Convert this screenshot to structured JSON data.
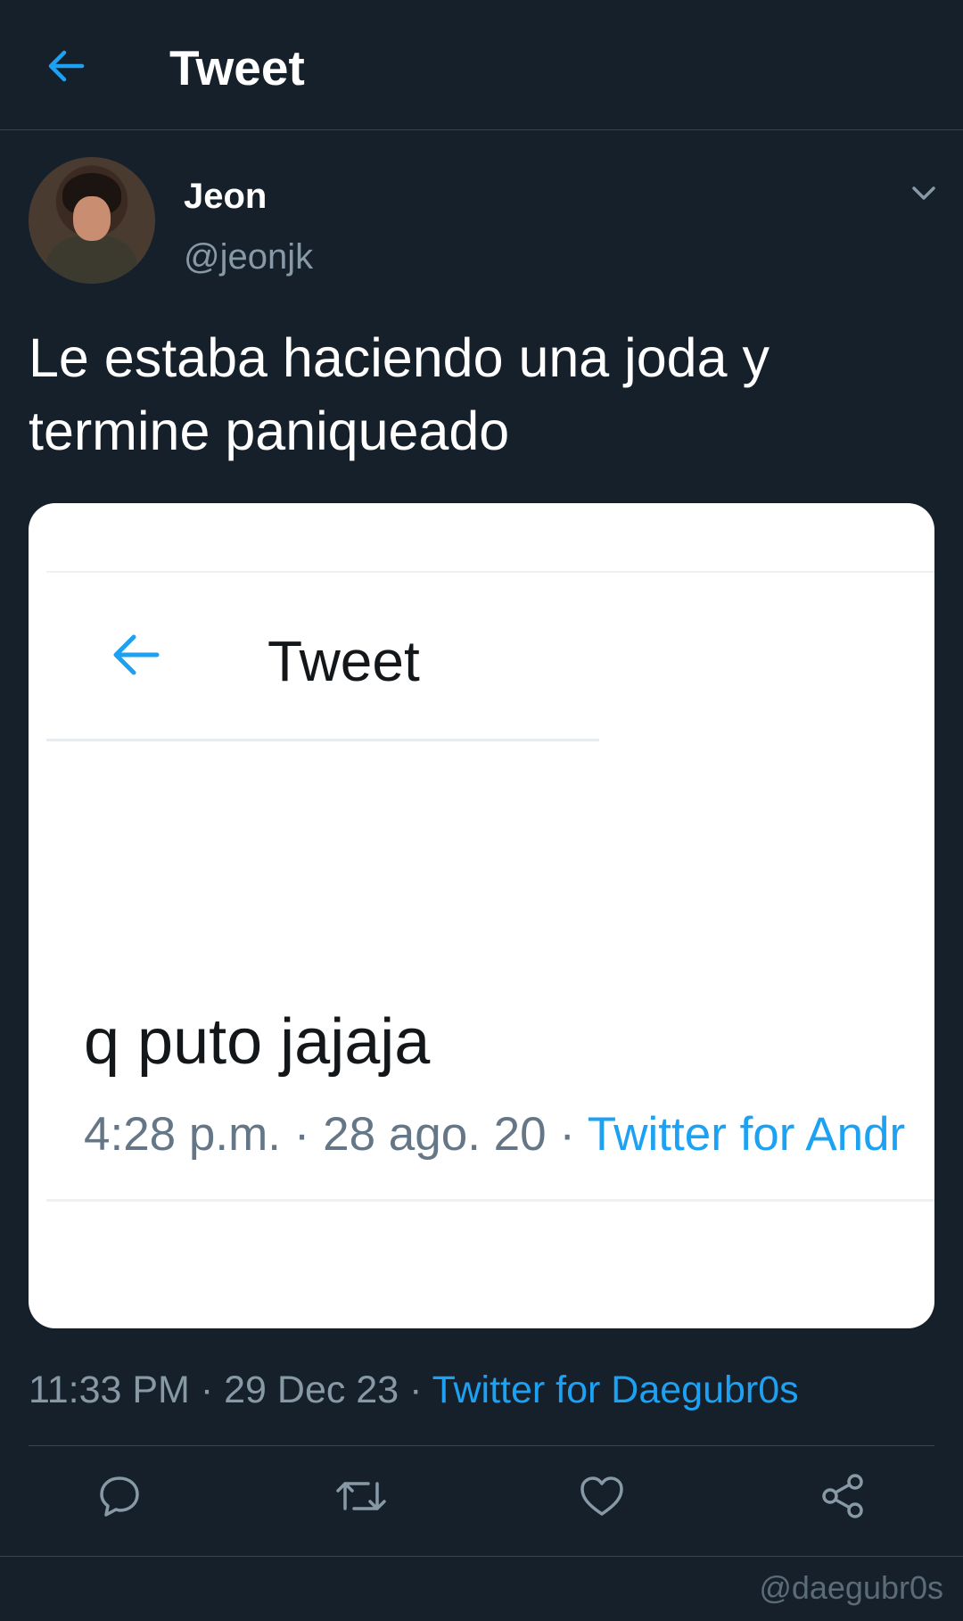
{
  "header": {
    "title": "Tweet",
    "back_icon": "arrow-left-icon"
  },
  "author": {
    "display_name": "Jeon",
    "handle": "@jeonjk"
  },
  "tweet": {
    "text": "Le estaba haciendo una joda y termine paniqueado",
    "time": "11:33 PM",
    "separator": "·",
    "date": "29 Dec 23",
    "source": "Twitter for Daegubr0s"
  },
  "embedded_screenshot": {
    "title": "Tweet",
    "text": "q puto jajaja",
    "time": "4:28 p.m.",
    "separator": "·",
    "date": "28 ago. 20",
    "source": "Twitter for Andr"
  },
  "actions": [
    {
      "name": "reply",
      "icon": "comment-icon"
    },
    {
      "name": "retweet",
      "icon": "retweet-icon"
    },
    {
      "name": "like",
      "icon": "heart-icon"
    },
    {
      "name": "share",
      "icon": "share-icon"
    }
  ],
  "watermark": "@daegubr0s",
  "colors": {
    "background": "#15202b",
    "accent": "#1da1f2",
    "secondary_text": "#8899a6",
    "divider": "#38444d"
  }
}
